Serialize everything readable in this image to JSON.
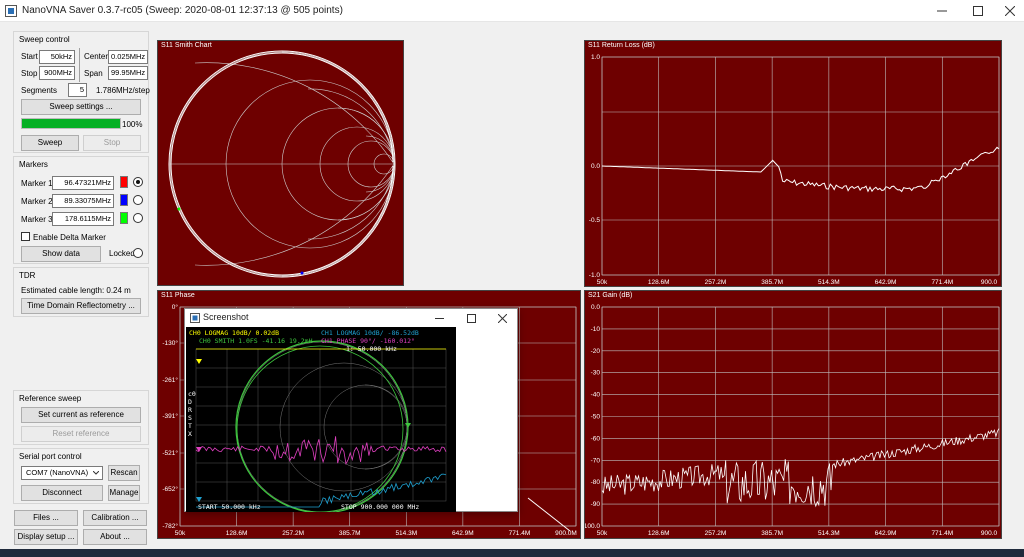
{
  "window": {
    "title": "NanoVNA Saver 0.3.7-rc05 (Sweep: 2020-08-01 12:37:13 @ 505 points)"
  },
  "colors": {
    "chart_bg": "#6e0000",
    "trace": "#ffffff",
    "progress": "#06b025"
  },
  "sweep_control": {
    "title": "Sweep control",
    "start_label": "Start",
    "start_value": "50kHz",
    "center_label": "Center",
    "center_value": "0.025MHz",
    "stop_label": "Stop",
    "stop_value": "900MHz",
    "span_label": "Span",
    "span_value": "99.95MHz",
    "segments_label": "Segments",
    "segments_value": "5",
    "step_text": "1.786MHz/step",
    "settings_button": "Sweep settings ...",
    "progress": 100,
    "progress_text": "100%",
    "sweep_button": "Sweep",
    "stop_button": "Stop"
  },
  "markers": {
    "title": "Markers",
    "items": [
      {
        "label": "Marker 1",
        "value": "96.47321MHz",
        "color": "#ff0000",
        "selected": true
      },
      {
        "label": "Marker 2",
        "value": "89.33075MHz",
        "color": "#0000ff",
        "selected": false
      },
      {
        "label": "Marker 3",
        "value": "178.6115MHz",
        "color": "#00ff00",
        "selected": false
      }
    ],
    "delta_label": "Enable Delta Marker",
    "show_data_button": "Show data",
    "locked_label": "Locked"
  },
  "tdr": {
    "title": "TDR",
    "cable_text": "Estimated cable length:  0.24 m",
    "tdr_button": "Time Domain Reflectometry ..."
  },
  "reference": {
    "title": "Reference sweep",
    "set_button": "Set current as reference",
    "reset_button": "Reset reference"
  },
  "serial": {
    "title": "Serial port control",
    "port": "COM7 (NanoVNA)",
    "rescan_button": "Rescan",
    "disconnect_button": "Disconnect",
    "manage_button": "Manage"
  },
  "bottom_buttons": {
    "files": "Files ...",
    "calibration": "Calibration ...",
    "display": "Display setup ...",
    "about": "About ..."
  },
  "charts": {
    "smith": {
      "title": "S11 Smith Chart"
    },
    "return_loss": {
      "title": "S11 Return Loss (dB)",
      "y_ticks": [
        "1.0",
        "0.0",
        "-0.5",
        "-1.0"
      ],
      "x_ticks": [
        "50k",
        "128.6M",
        "257.2M",
        "385.7M",
        "514.3M",
        "642.9M",
        "771.4M",
        "900.0"
      ]
    },
    "phase": {
      "title": "S11 Phase",
      "y_ticks": [
        "0°",
        "-130°",
        "-261°",
        "-391°",
        "-521°",
        "-652°",
        "-782°"
      ],
      "x_ticks": [
        "50k",
        "128.6M",
        "257.2M",
        "385.7M",
        "514.3M",
        "642.9M",
        "771.4M",
        "900.0M"
      ]
    },
    "gain": {
      "title": "S21 Gain (dB)",
      "y_ticks": [
        "0.0",
        "-10",
        "-20",
        "-30",
        "-40",
        "-50",
        "-60",
        "-70",
        "-80",
        "-90",
        "-100.0"
      ],
      "x_ticks": [
        "50k",
        "128.6M",
        "257.2M",
        "385.7M",
        "514.3M",
        "642.9M",
        "771.4M",
        "900.0"
      ]
    }
  },
  "screenshot_popup": {
    "title": "Screenshot",
    "lines": {
      "ch0": "CH0 LOGMAG 10dB/ 0.02dB",
      "ch1": "CH1 LOGMAG 10dB/ -86.52dB",
      "smith": "CH0 SMITH 1.0FS  -41.16 19.2mH",
      "phase": "CH1 PHASE 90°/  -160.012°",
      "marker": "1: 50.000 kHz",
      "start": "START 50.000 kHz",
      "stop": "STOP 900.000 000 MHz",
      "side": [
        "c0",
        "D",
        "R",
        "S",
        "T",
        "X"
      ]
    }
  }
}
